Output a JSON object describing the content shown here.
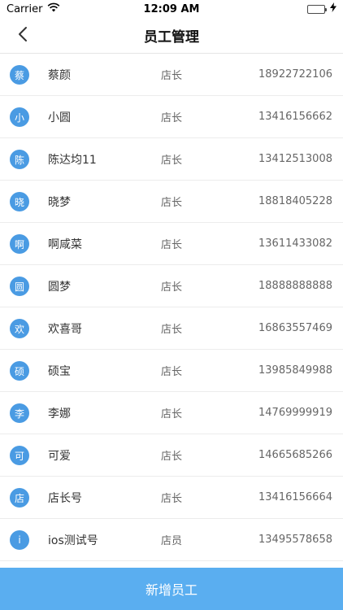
{
  "status_bar": {
    "carrier": "Carrier",
    "time": "12:09 AM",
    "battery_level": 1.0,
    "battery_color": "#4cd964"
  },
  "nav": {
    "title": "员工管理",
    "back_icon": "chevron-left-icon"
  },
  "employees": [
    {
      "avatar": "蔡",
      "name": "蔡颜",
      "role": "店长",
      "phone": "18922722106"
    },
    {
      "avatar": "小",
      "name": "小圆",
      "role": "店长",
      "phone": "13416156662"
    },
    {
      "avatar": "陈",
      "name": "陈达均11",
      "role": "店长",
      "phone": "13412513008"
    },
    {
      "avatar": "晓",
      "name": "晓梦",
      "role": "店长",
      "phone": "18818405228"
    },
    {
      "avatar": "啊",
      "name": "啊咸菜",
      "role": "店长",
      "phone": "13611433082"
    },
    {
      "avatar": "圆",
      "name": "圆梦",
      "role": "店长",
      "phone": "18888888888"
    },
    {
      "avatar": "欢",
      "name": "欢喜哥",
      "role": "店长",
      "phone": "16863557469"
    },
    {
      "avatar": "硕",
      "name": "硕宝",
      "role": "店长",
      "phone": "13985849988"
    },
    {
      "avatar": "李",
      "name": "李娜",
      "role": "店长",
      "phone": "14769999919"
    },
    {
      "avatar": "可",
      "name": "可爱",
      "role": "店长",
      "phone": "14665685266"
    },
    {
      "avatar": "店",
      "name": "店长号",
      "role": "店长",
      "phone": "13416156664"
    },
    {
      "avatar": "i",
      "name": "ios测试号",
      "role": "店员",
      "phone": "13495578658"
    }
  ],
  "footer": {
    "add_label": "新增员工"
  },
  "colors": {
    "accent": "#5aaef0",
    "avatar_bg": "#4a9be3"
  }
}
